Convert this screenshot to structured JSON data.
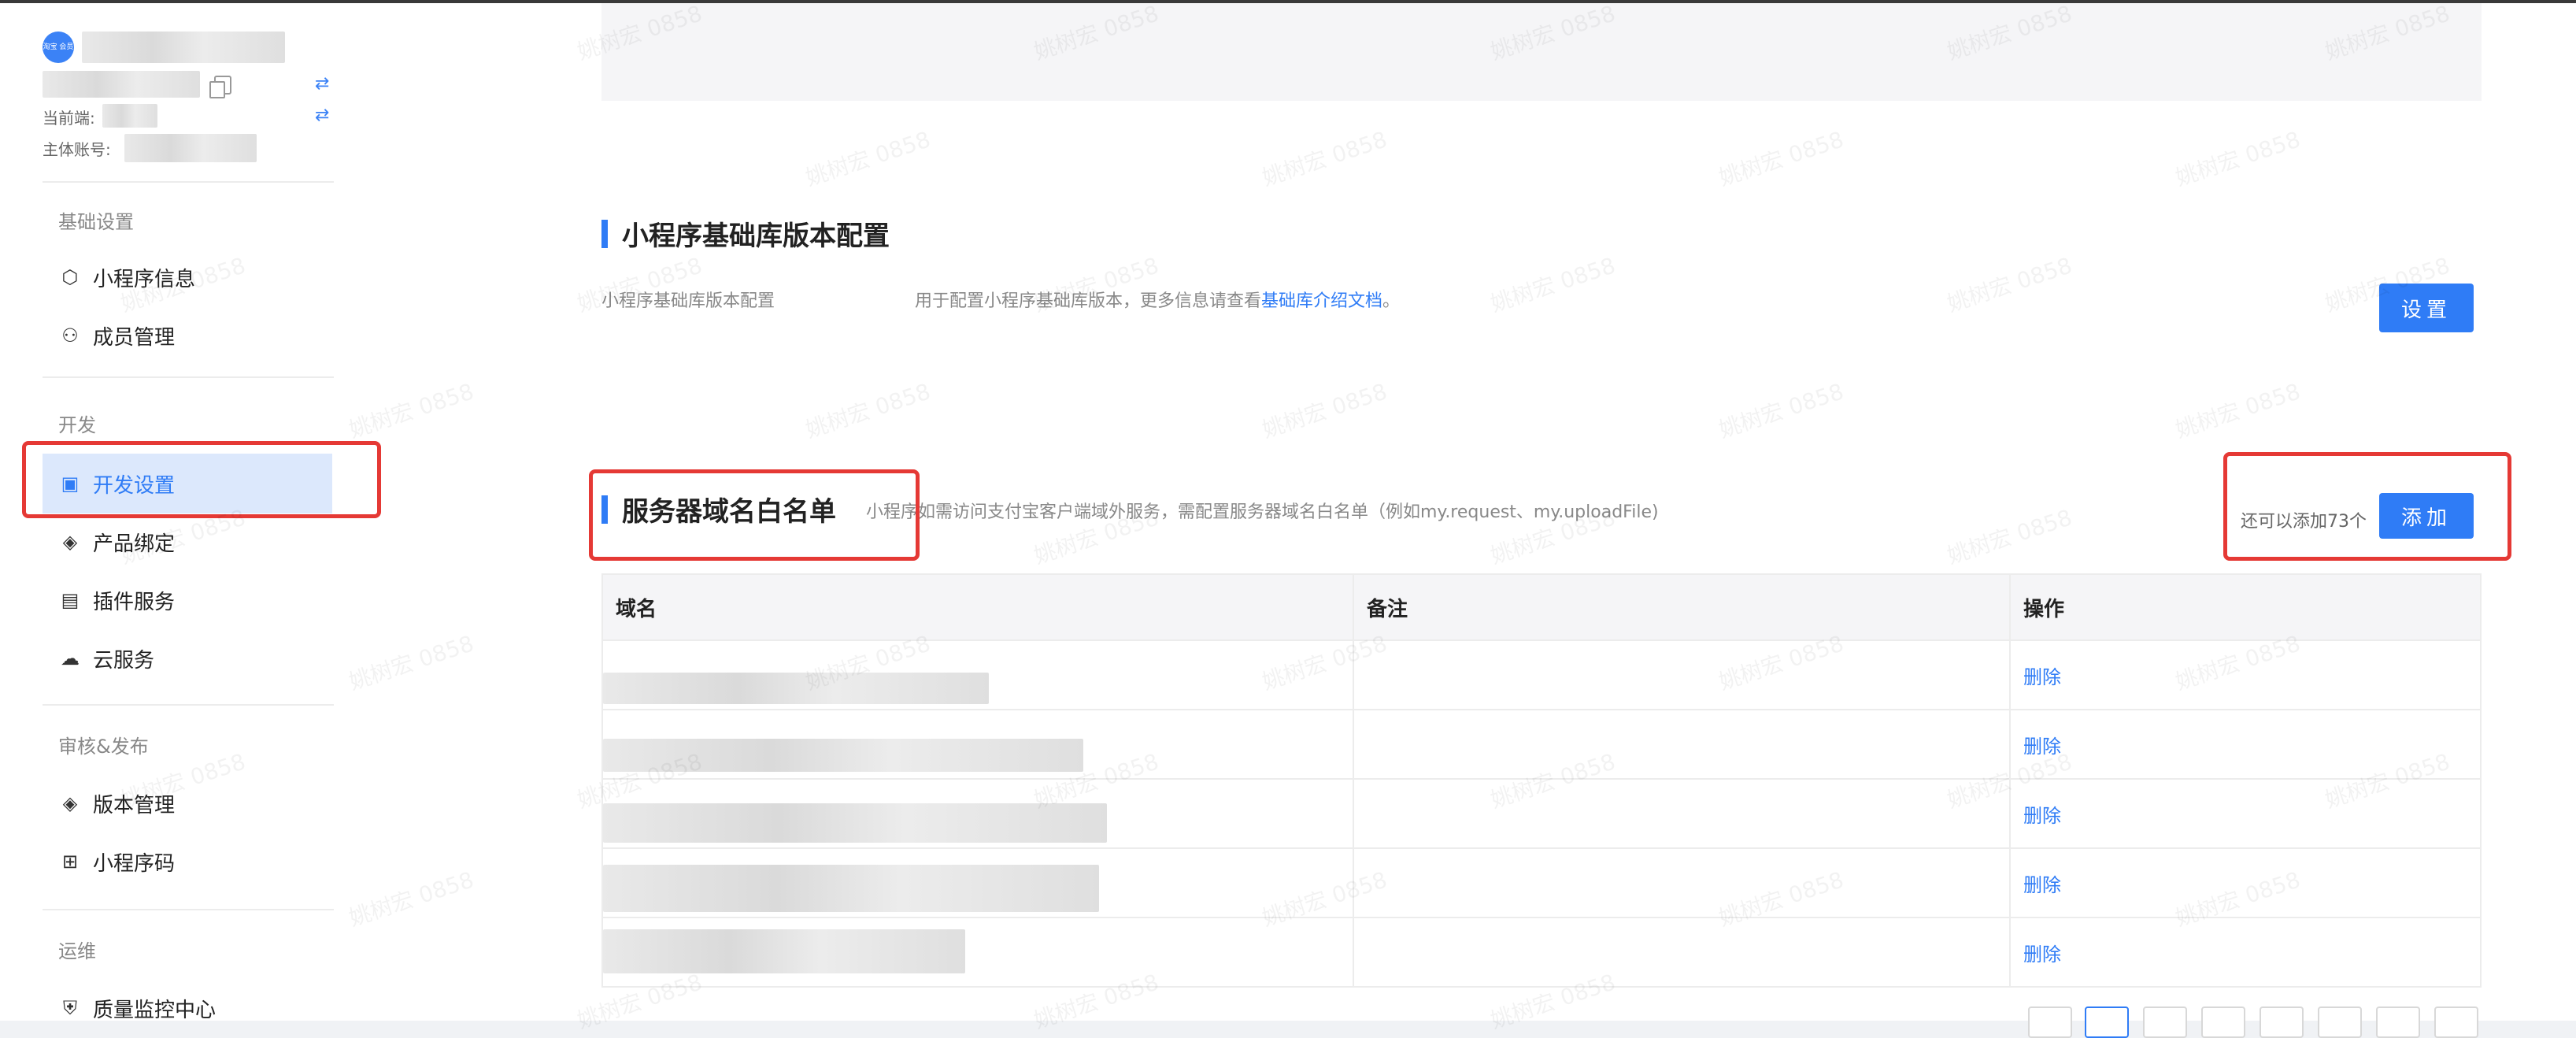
{
  "sidebar": {
    "logo_text": "淘宝 会员",
    "current_end_label": "当前端:",
    "main_account_label": "主体账号:",
    "groups": [
      {
        "title": "基础设置",
        "items": [
          {
            "label": "小程序信息",
            "icon": "cube-icon"
          },
          {
            "label": "成员管理",
            "icon": "users-icon"
          }
        ]
      },
      {
        "title": "开发",
        "items": [
          {
            "label": "开发设置",
            "icon": "dev-settings-icon",
            "active": true
          },
          {
            "label": "产品绑定",
            "icon": "layers-icon"
          },
          {
            "label": "插件服务",
            "icon": "plugin-icon"
          },
          {
            "label": "云服务",
            "icon": "cloud-icon"
          }
        ]
      },
      {
        "title": "审核&发布",
        "items": [
          {
            "label": "版本管理",
            "icon": "layers-icon"
          },
          {
            "label": "小程序码",
            "icon": "grid-icon"
          }
        ]
      },
      {
        "title": "运维",
        "items": [
          {
            "label": "质量监控中心",
            "icon": "shield-icon"
          }
        ]
      }
    ]
  },
  "base_lib": {
    "title": "小程序基础库版本配置",
    "row_label": "小程序基础库版本配置",
    "desc_prefix": "用于配置小程序基础库版本，更多信息请查看",
    "desc_link": "基础库介绍文档",
    "desc_suffix": "。",
    "button": "设置"
  },
  "whitelist": {
    "title": "服务器域名白名单",
    "desc": "小程序如需访问支付宝客户端域外服务，需配置服务器域名白名单（例如my.request、my.uploadFile)",
    "remaining": "还可以添加73个",
    "add_button": "添加",
    "columns": [
      "域名",
      "备注",
      "操作"
    ],
    "rows": [
      {
        "action": "删除"
      },
      {
        "action": "删除"
      },
      {
        "action": "删除"
      },
      {
        "action": "删除"
      },
      {
        "action": "删除"
      }
    ]
  },
  "watermark": "姚树宏 0858",
  "colors": {
    "accent": "#2f7cf6",
    "highlight": "#e53935",
    "active_bg": "#dce8fc"
  }
}
